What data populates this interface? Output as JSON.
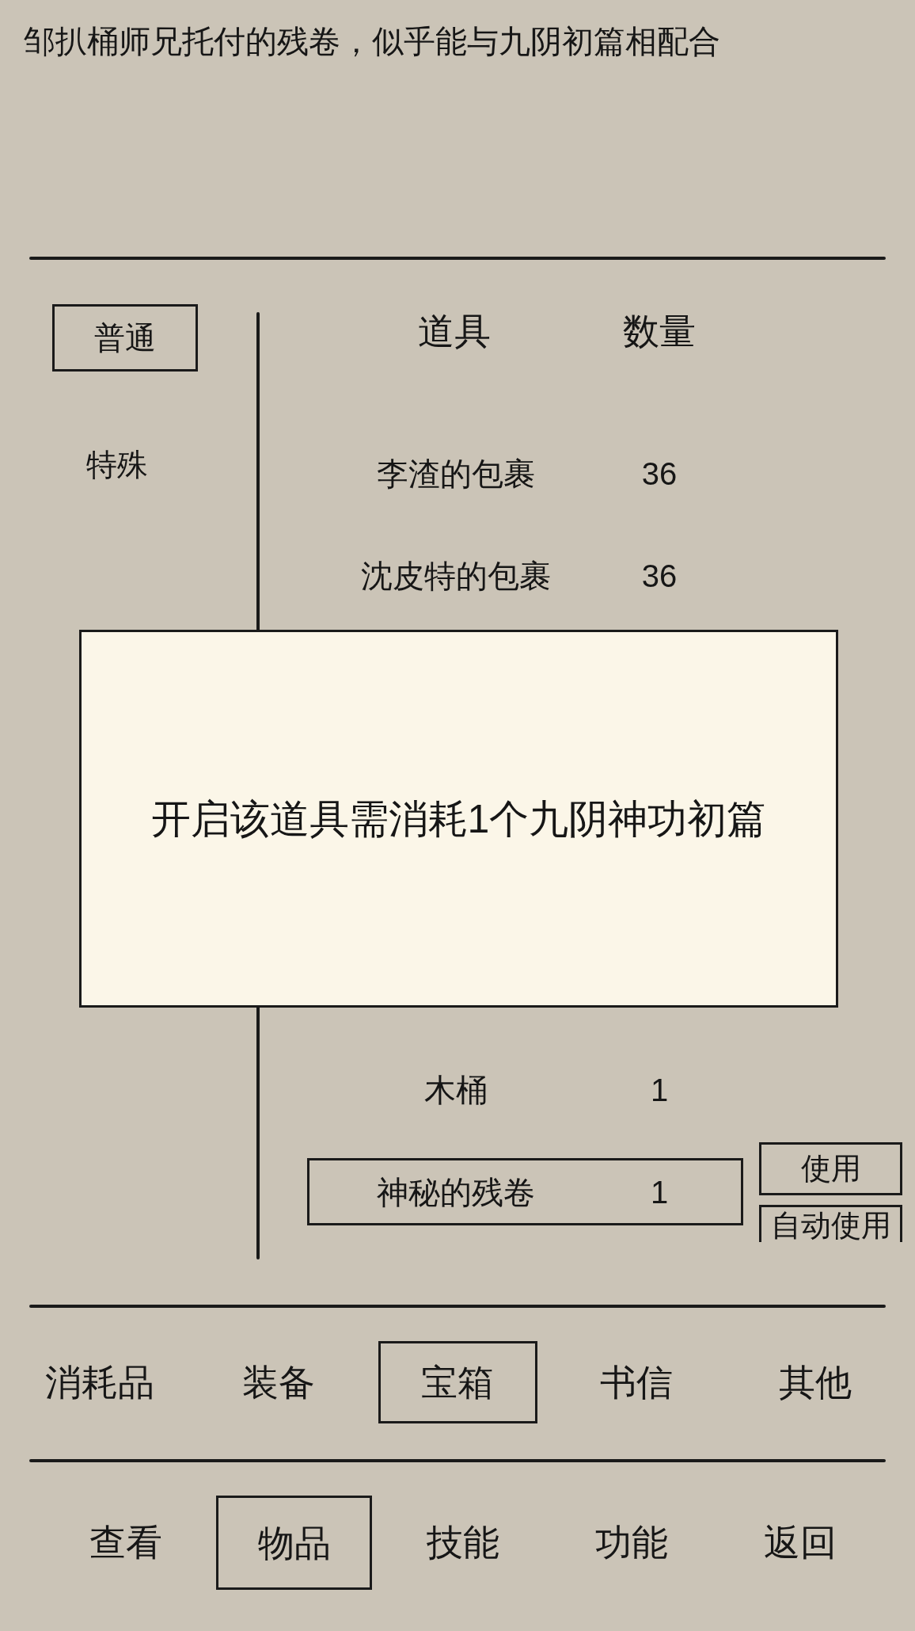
{
  "description": "邹扒桶师兄托付的残卷，似乎能与九阴初篇相配合",
  "rarity_tabs": [
    {
      "label": "普通",
      "selected": true
    },
    {
      "label": "特殊",
      "selected": false
    }
  ],
  "item_list": {
    "columns": [
      "道具",
      "数量"
    ],
    "rows": [
      {
        "name": "李渣的包裹",
        "quantity": "36",
        "selected": false
      },
      {
        "name": "沈皮特的包裹",
        "quantity": "36",
        "selected": false
      },
      {
        "name": "木桶",
        "quantity": "1",
        "selected": false
      },
      {
        "name": "神秘的残卷",
        "quantity": "1",
        "selected": true
      }
    ],
    "actions": [
      "使用",
      "自动使用"
    ]
  },
  "dialog": {
    "message": "开启该道具需消耗1个九阴神功初篇"
  },
  "category_tabs": [
    {
      "label": "消耗品",
      "selected": false
    },
    {
      "label": "装备",
      "selected": false
    },
    {
      "label": "宝箱",
      "selected": true
    },
    {
      "label": "书信",
      "selected": false
    },
    {
      "label": "其他",
      "selected": false
    }
  ],
  "nav_tabs": [
    {
      "label": "查看",
      "selected": false
    },
    {
      "label": "物品",
      "selected": true
    },
    {
      "label": "技能",
      "selected": false
    },
    {
      "label": "功能",
      "selected": false
    },
    {
      "label": "返回",
      "selected": false
    }
  ]
}
